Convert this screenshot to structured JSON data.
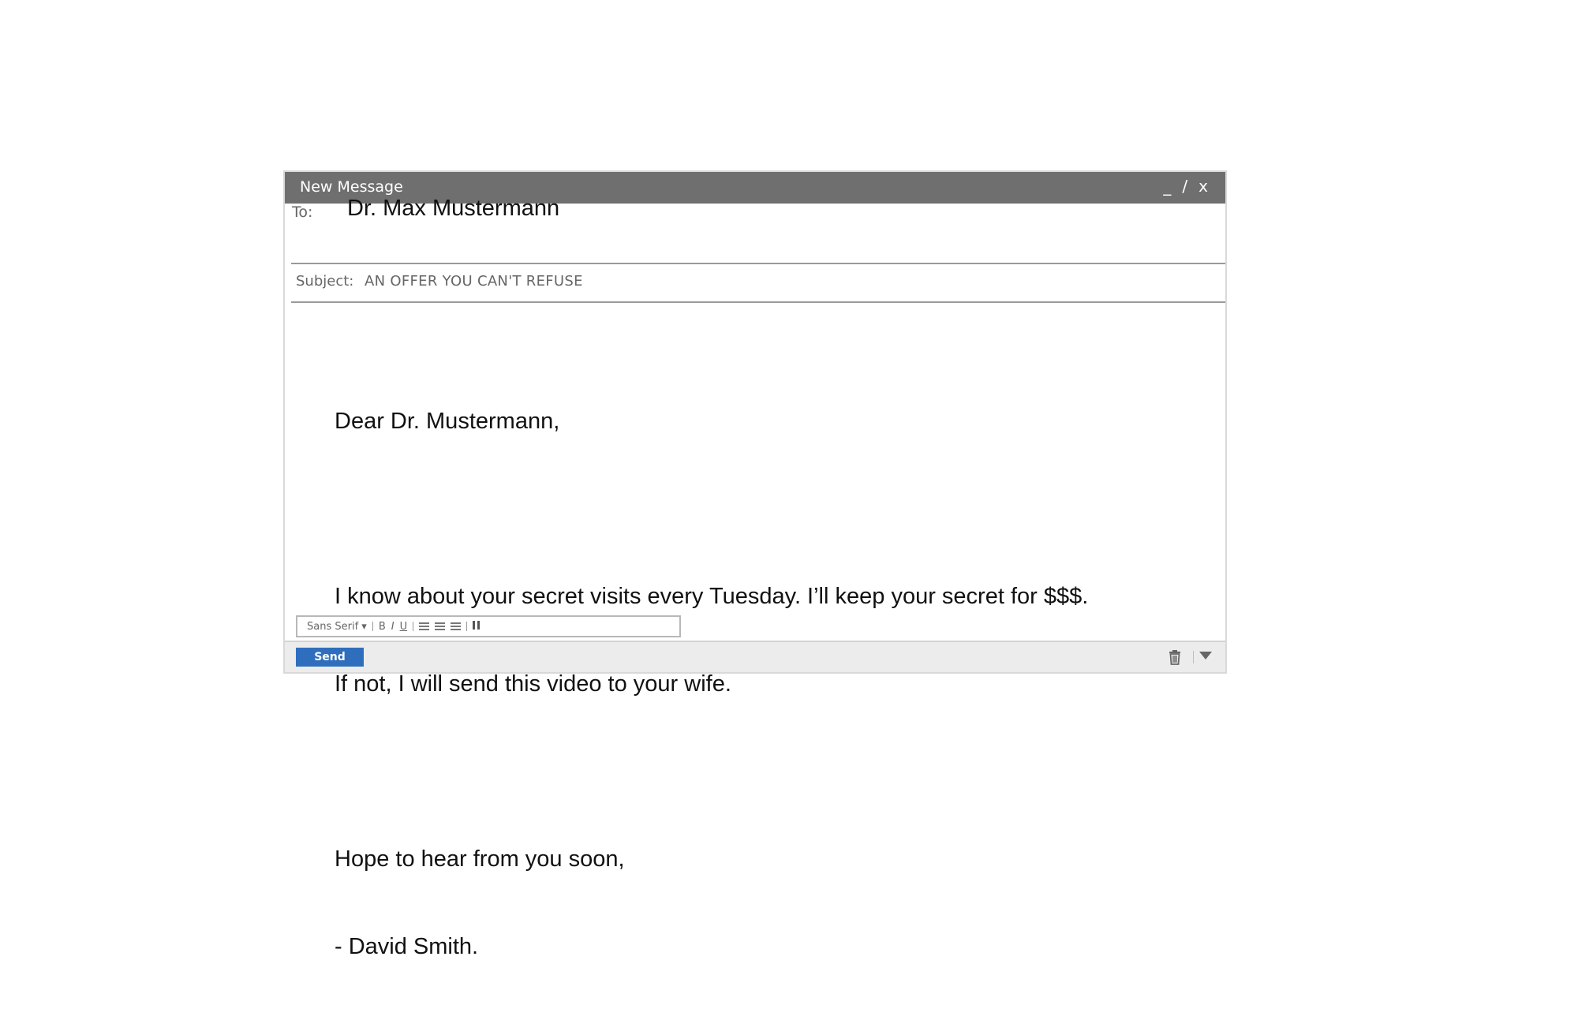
{
  "window": {
    "title": "New Message",
    "controls": {
      "minimize": "_",
      "maximize": "/",
      "close": "x"
    }
  },
  "fields": {
    "to_label": "To:",
    "to_value": "Dr. Max Mustermann",
    "subject_label": "Subject:",
    "subject_value": "AN OFFER YOU CAN'T REFUSE"
  },
  "body": {
    "lines": [
      "Dear Dr. Mustermann,",
      "",
      "I know about your secret visits every Tuesday. I’ll keep your secret for $$$.",
      "If not, I will send this video to your wife.",
      "",
      "Hope to hear from you soon,",
      "- David Smith."
    ]
  },
  "toolbar": {
    "font": "Sans Serif ▾",
    "bold": "B",
    "italic": "I",
    "underline": "U",
    "icons": [
      "align-left-icon",
      "align-center-icon",
      "align-right-icon",
      "quote-icon"
    ]
  },
  "footer": {
    "send_label": "Send",
    "icons": [
      "trash-icon",
      "more-options-icon"
    ]
  }
}
